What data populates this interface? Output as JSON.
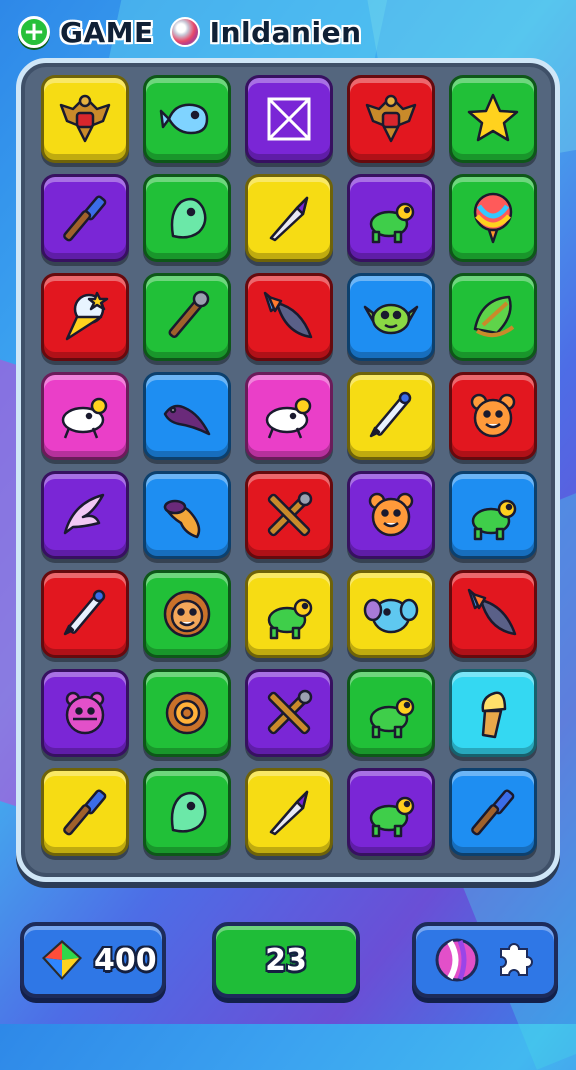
{
  "header": {
    "plus_icon": "plus-icon",
    "game_label": "GAME",
    "ball_icon": "ball-icon",
    "player_name": "Inldanien"
  },
  "board": {
    "rows": [
      [
        {
          "color": "yellow",
          "icon": "eagle-emblem-icon"
        },
        {
          "color": "green",
          "icon": "ghost-fish-icon"
        },
        {
          "color": "purple",
          "icon": "envelope-box-icon"
        },
        {
          "color": "red",
          "icon": "eagle-emblem-icon"
        },
        {
          "color": "green",
          "icon": "star-icon"
        }
      ],
      [
        {
          "color": "purple",
          "icon": "paintbrush-icon"
        },
        {
          "color": "green",
          "icon": "ghost-icon"
        },
        {
          "color": "yellow",
          "icon": "arrowhead-icon"
        },
        {
          "color": "purple",
          "icon": "turtle-icon"
        },
        {
          "color": "green",
          "icon": "balloon-icon"
        }
      ],
      [
        {
          "color": "red",
          "icon": "ice-cream-icon"
        },
        {
          "color": "green",
          "icon": "wrench-stick-icon"
        },
        {
          "color": "red",
          "icon": "feather-rocket-icon"
        },
        {
          "color": "blue",
          "icon": "alien-icon"
        },
        {
          "color": "green",
          "icon": "slingshot-icon"
        }
      ],
      [
        {
          "color": "pink",
          "icon": "creature-icon"
        },
        {
          "color": "blue",
          "icon": "dino-icon"
        },
        {
          "color": "pink",
          "icon": "creature-icon"
        },
        {
          "color": "yellow",
          "icon": "pen-icon"
        },
        {
          "color": "red",
          "icon": "bear-face-icon"
        }
      ],
      [
        {
          "color": "purple",
          "icon": "leaf-bird-icon"
        },
        {
          "color": "blue",
          "icon": "shrimp-icon"
        },
        {
          "color": "red",
          "icon": "crossed-tools-icon"
        },
        {
          "color": "purple",
          "icon": "bear-face-icon"
        },
        {
          "color": "blue",
          "icon": "turtle-icon"
        }
      ],
      [
        {
          "color": "red",
          "icon": "pen-icon"
        },
        {
          "color": "green",
          "icon": "sun-face-icon"
        },
        {
          "color": "yellow",
          "icon": "turtle-icon"
        },
        {
          "color": "yellow",
          "icon": "elephant-icon"
        },
        {
          "color": "red",
          "icon": "feather-rocket-icon"
        }
      ],
      [
        {
          "color": "purple",
          "icon": "pig-face-icon"
        },
        {
          "color": "green",
          "icon": "gear-icon"
        },
        {
          "color": "purple",
          "icon": "crossed-tools-icon"
        },
        {
          "color": "green",
          "icon": "turtle-icon"
        },
        {
          "color": "cyan",
          "icon": "ice-cream-cone-icon"
        }
      ],
      [
        {
          "color": "yellow",
          "icon": "paintbrush-icon"
        },
        {
          "color": "green",
          "icon": "ghost-icon"
        },
        {
          "color": "yellow",
          "icon": "arrowhead-icon"
        },
        {
          "color": "purple",
          "icon": "turtle-icon"
        },
        {
          "color": "blue",
          "icon": "paintbrush-icon"
        }
      ]
    ]
  },
  "footer": {
    "gems_icon": "gem-icon",
    "gems_count": "400",
    "moves_count": "23",
    "tool_1_icon": "striped-ball-icon",
    "tool_2_icon": "puzzle-piece-icon"
  },
  "colors": {
    "yellow": "#f6dc14",
    "green": "#21c038",
    "purple": "#7a26d6",
    "red": "#e2171f",
    "blue": "#1e8ef2",
    "pink": "#ea3fc8",
    "cyan": "#34d8f2"
  }
}
